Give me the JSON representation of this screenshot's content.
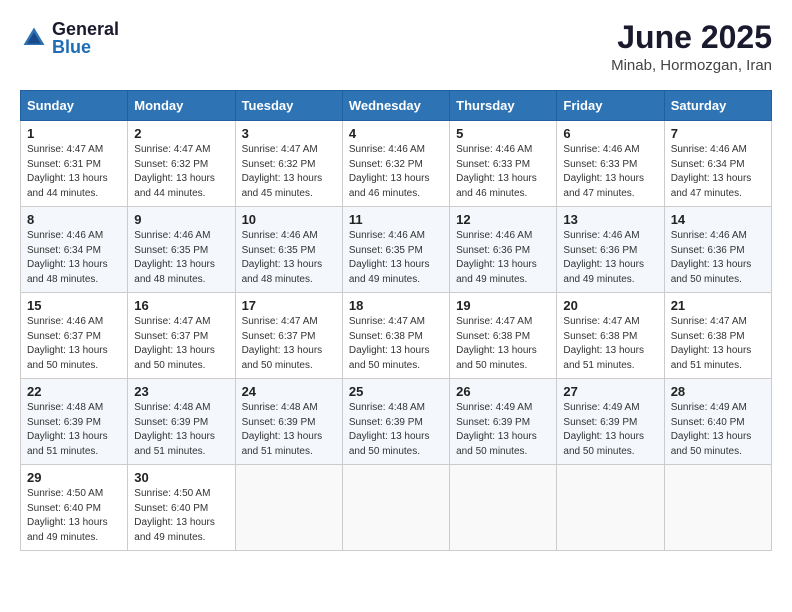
{
  "header": {
    "logo_general": "General",
    "logo_blue": "Blue",
    "title": "June 2025",
    "subtitle": "Minab, Hormozgan, Iran"
  },
  "days_of_week": [
    "Sunday",
    "Monday",
    "Tuesday",
    "Wednesday",
    "Thursday",
    "Friday",
    "Saturday"
  ],
  "weeks": [
    [
      {
        "day": "1",
        "sunrise": "Sunrise: 4:47 AM",
        "sunset": "Sunset: 6:31 PM",
        "daylight": "Daylight: 13 hours and 44 minutes."
      },
      {
        "day": "2",
        "sunrise": "Sunrise: 4:47 AM",
        "sunset": "Sunset: 6:32 PM",
        "daylight": "Daylight: 13 hours and 44 minutes."
      },
      {
        "day": "3",
        "sunrise": "Sunrise: 4:47 AM",
        "sunset": "Sunset: 6:32 PM",
        "daylight": "Daylight: 13 hours and 45 minutes."
      },
      {
        "day": "4",
        "sunrise": "Sunrise: 4:46 AM",
        "sunset": "Sunset: 6:32 PM",
        "daylight": "Daylight: 13 hours and 46 minutes."
      },
      {
        "day": "5",
        "sunrise": "Sunrise: 4:46 AM",
        "sunset": "Sunset: 6:33 PM",
        "daylight": "Daylight: 13 hours and 46 minutes."
      },
      {
        "day": "6",
        "sunrise": "Sunrise: 4:46 AM",
        "sunset": "Sunset: 6:33 PM",
        "daylight": "Daylight: 13 hours and 47 minutes."
      },
      {
        "day": "7",
        "sunrise": "Sunrise: 4:46 AM",
        "sunset": "Sunset: 6:34 PM",
        "daylight": "Daylight: 13 hours and 47 minutes."
      }
    ],
    [
      {
        "day": "8",
        "sunrise": "Sunrise: 4:46 AM",
        "sunset": "Sunset: 6:34 PM",
        "daylight": "Daylight: 13 hours and 48 minutes."
      },
      {
        "day": "9",
        "sunrise": "Sunrise: 4:46 AM",
        "sunset": "Sunset: 6:35 PM",
        "daylight": "Daylight: 13 hours and 48 minutes."
      },
      {
        "day": "10",
        "sunrise": "Sunrise: 4:46 AM",
        "sunset": "Sunset: 6:35 PM",
        "daylight": "Daylight: 13 hours and 48 minutes."
      },
      {
        "day": "11",
        "sunrise": "Sunrise: 4:46 AM",
        "sunset": "Sunset: 6:35 PM",
        "daylight": "Daylight: 13 hours and 49 minutes."
      },
      {
        "day": "12",
        "sunrise": "Sunrise: 4:46 AM",
        "sunset": "Sunset: 6:36 PM",
        "daylight": "Daylight: 13 hours and 49 minutes."
      },
      {
        "day": "13",
        "sunrise": "Sunrise: 4:46 AM",
        "sunset": "Sunset: 6:36 PM",
        "daylight": "Daylight: 13 hours and 49 minutes."
      },
      {
        "day": "14",
        "sunrise": "Sunrise: 4:46 AM",
        "sunset": "Sunset: 6:36 PM",
        "daylight": "Daylight: 13 hours and 50 minutes."
      }
    ],
    [
      {
        "day": "15",
        "sunrise": "Sunrise: 4:46 AM",
        "sunset": "Sunset: 6:37 PM",
        "daylight": "Daylight: 13 hours and 50 minutes."
      },
      {
        "day": "16",
        "sunrise": "Sunrise: 4:47 AM",
        "sunset": "Sunset: 6:37 PM",
        "daylight": "Daylight: 13 hours and 50 minutes."
      },
      {
        "day": "17",
        "sunrise": "Sunrise: 4:47 AM",
        "sunset": "Sunset: 6:37 PM",
        "daylight": "Daylight: 13 hours and 50 minutes."
      },
      {
        "day": "18",
        "sunrise": "Sunrise: 4:47 AM",
        "sunset": "Sunset: 6:38 PM",
        "daylight": "Daylight: 13 hours and 50 minutes."
      },
      {
        "day": "19",
        "sunrise": "Sunrise: 4:47 AM",
        "sunset": "Sunset: 6:38 PM",
        "daylight": "Daylight: 13 hours and 50 minutes."
      },
      {
        "day": "20",
        "sunrise": "Sunrise: 4:47 AM",
        "sunset": "Sunset: 6:38 PM",
        "daylight": "Daylight: 13 hours and 51 minutes."
      },
      {
        "day": "21",
        "sunrise": "Sunrise: 4:47 AM",
        "sunset": "Sunset: 6:38 PM",
        "daylight": "Daylight: 13 hours and 51 minutes."
      }
    ],
    [
      {
        "day": "22",
        "sunrise": "Sunrise: 4:48 AM",
        "sunset": "Sunset: 6:39 PM",
        "daylight": "Daylight: 13 hours and 51 minutes."
      },
      {
        "day": "23",
        "sunrise": "Sunrise: 4:48 AM",
        "sunset": "Sunset: 6:39 PM",
        "daylight": "Daylight: 13 hours and 51 minutes."
      },
      {
        "day": "24",
        "sunrise": "Sunrise: 4:48 AM",
        "sunset": "Sunset: 6:39 PM",
        "daylight": "Daylight: 13 hours and 51 minutes."
      },
      {
        "day": "25",
        "sunrise": "Sunrise: 4:48 AM",
        "sunset": "Sunset: 6:39 PM",
        "daylight": "Daylight: 13 hours and 50 minutes."
      },
      {
        "day": "26",
        "sunrise": "Sunrise: 4:49 AM",
        "sunset": "Sunset: 6:39 PM",
        "daylight": "Daylight: 13 hours and 50 minutes."
      },
      {
        "day": "27",
        "sunrise": "Sunrise: 4:49 AM",
        "sunset": "Sunset: 6:39 PM",
        "daylight": "Daylight: 13 hours and 50 minutes."
      },
      {
        "day": "28",
        "sunrise": "Sunrise: 4:49 AM",
        "sunset": "Sunset: 6:40 PM",
        "daylight": "Daylight: 13 hours and 50 minutes."
      }
    ],
    [
      {
        "day": "29",
        "sunrise": "Sunrise: 4:50 AM",
        "sunset": "Sunset: 6:40 PM",
        "daylight": "Daylight: 13 hours and 49 minutes."
      },
      {
        "day": "30",
        "sunrise": "Sunrise: 4:50 AM",
        "sunset": "Sunset: 6:40 PM",
        "daylight": "Daylight: 13 hours and 49 minutes."
      },
      null,
      null,
      null,
      null,
      null
    ]
  ]
}
